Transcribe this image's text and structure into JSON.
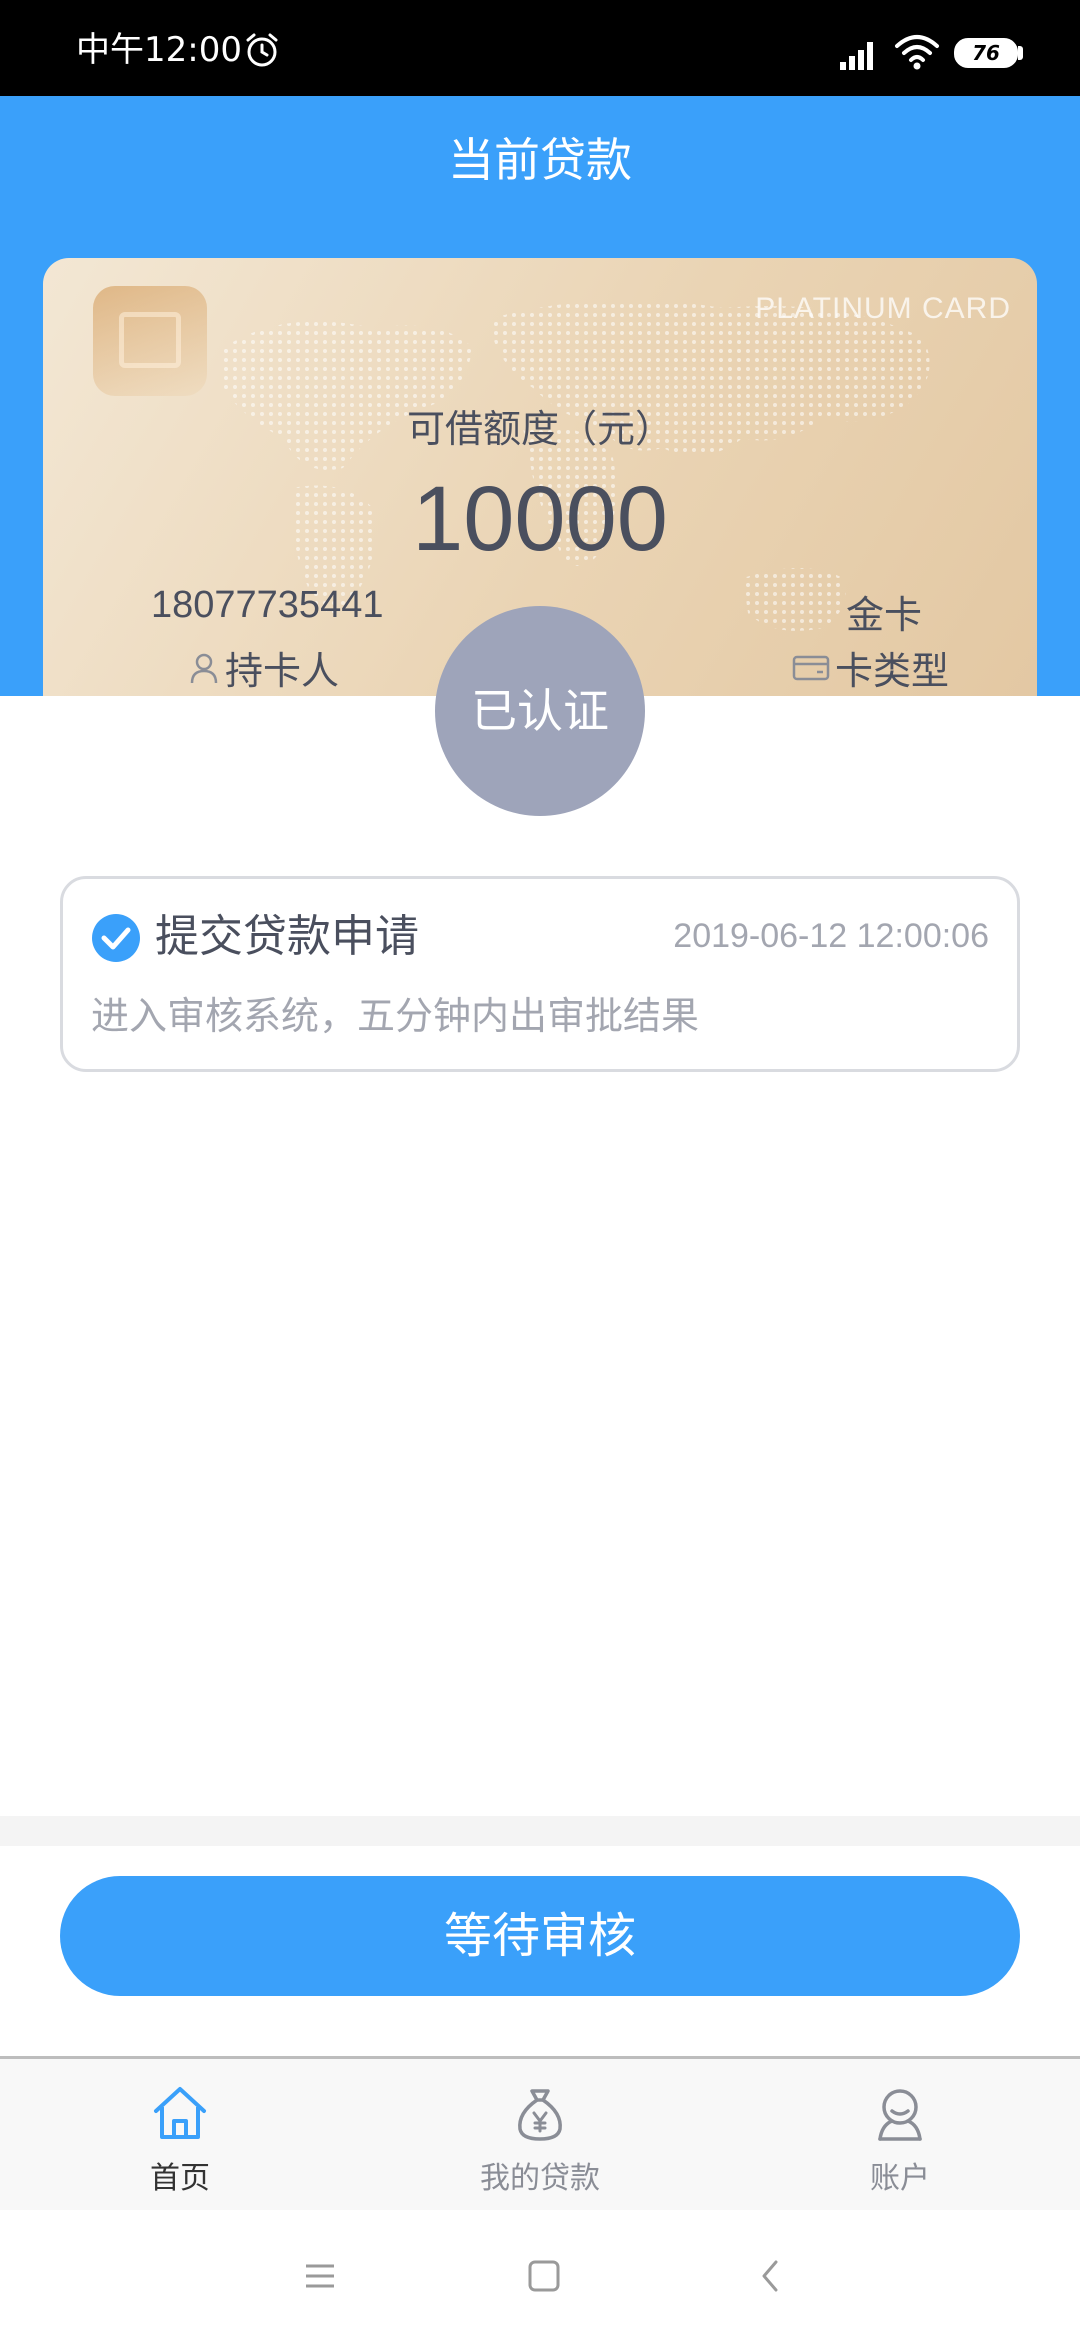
{
  "status_bar": {
    "time": "中午12:00",
    "battery": "76"
  },
  "header": {
    "title": "当前贷款"
  },
  "card": {
    "brand": "PLATINUM CARD",
    "limit_label": "可借额度（元）",
    "limit_amount": "10000",
    "holder_phone": "18077735441",
    "holder_label": "持卡人",
    "card_type_value": "金卡",
    "card_type_label": "卡类型"
  },
  "verified_badge": "已认证",
  "application": {
    "title": "提交贷款申请",
    "time": "2019-06-12 12:00:06",
    "description": "进入审核系统，五分钟内出审批结果"
  },
  "action_button": "等待审核",
  "tabs": [
    {
      "label": "首页",
      "icon": "home-icon",
      "active": true
    },
    {
      "label": "我的贷款",
      "icon": "money-bag-icon",
      "active": false
    },
    {
      "label": "账户",
      "icon": "account-icon",
      "active": false
    }
  ],
  "colors": {
    "primary": "#3aa0fa",
    "badge": "#9ea4ba",
    "text_dark": "#4a4f5e",
    "text_muted": "#a3a6b0",
    "tab_inactive": "#8a8d96"
  }
}
